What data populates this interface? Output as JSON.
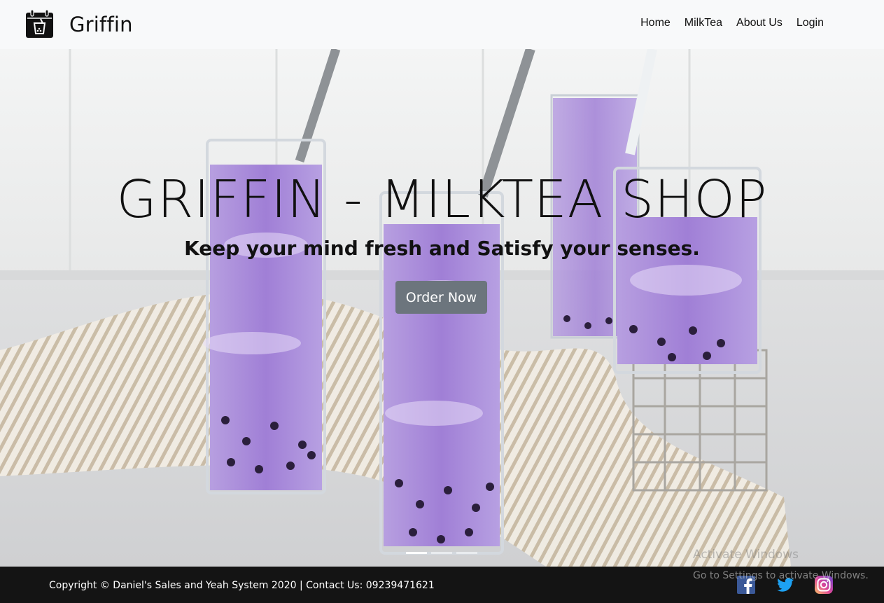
{
  "navbar": {
    "brand": "Griffin",
    "logo_icon": "calendar-milktea-icon",
    "links": [
      "Home",
      "MilkTea",
      "About Us",
      "Login"
    ]
  },
  "hero": {
    "title": "GRIFFIN - MILKTEA SHOP",
    "subtitle": "Keep your mind fresh and Satisfy your senses.",
    "cta_label": "Order Now",
    "carousel_slide_count": 3,
    "carousel_active_index": 0
  },
  "footer": {
    "copyright": "Copyright © Daniel's Sales and Yeah System 2020 | Contact Us: 09239471621",
    "social_icons": [
      "facebook-icon",
      "twitter-icon",
      "instagram-icon"
    ]
  },
  "watermark": {
    "line1": "Activate Windows",
    "line2": "Go to Settings to activate Windows."
  },
  "colors": {
    "navbar_bg": "#f8f9fa",
    "button_bg": "#6c757d",
    "footer_bg": "#141414",
    "drink_purple": "#a98ad8",
    "facebook": "#3b5998",
    "twitter": "#1da1f2"
  }
}
